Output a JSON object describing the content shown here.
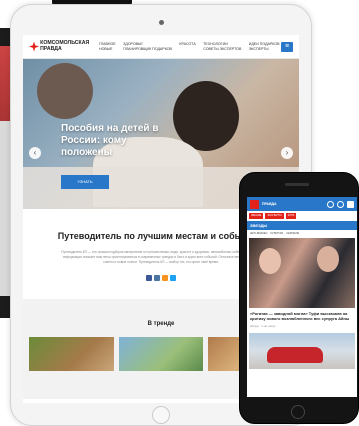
{
  "brand": {
    "logo_text": "КОМСОМОЛЬСКАЯ ПРАВДА",
    "accent": "#2977c9",
    "brand_red": "#e2231a"
  },
  "tablet": {
    "nav": [
      "ГЛАВНОЕ",
      "ЗДОРОВЬЕ",
      "КРАСОТА",
      "ТЕХНОЛОГИИ",
      "ИДЕИ ПОДАРКОВ",
      "НОВЫЕ",
      "ПЛАНИРОВЩИК ПОДАРКОВ",
      "",
      "СОВЕТЫ ЭКСПЕРТОВ",
      "ЭКСПЕРТЫ"
    ],
    "menu_icon": "menu-icon",
    "hero": {
      "title": "Пособия на детей в России: кому положены",
      "button": "Узнать"
    },
    "guide": {
      "title": "Путеводитель по лучшим местам и событиям",
      "text": "Путеводитель КП — это лучшая подборка материалов по путешествиям, моде, красоте и здоровью, автомобилям, киберспорту. Наша информация поможет вам легко ориентироваться в современных трендах и быть в курсе всех событий. Отличные места, полезные советы и новые статьи. Путеводитель КП — выбор тех, кто ценит своё время."
    },
    "trend_title": "В тренде"
  },
  "phone": {
    "logo": "ПРАВДА",
    "tabs": [
      "ЗВАНИЕ",
      "ЭКСПЕРТЫ",
      "КЛУБ"
    ],
    "stars": "ЗВЕЗДЫ",
    "tags": [
      "ШОУ-БИЗНЕС",
      "КУЛЬТУРА",
      "СЕРИАЛЫ"
    ],
    "caption": "«Рогатая — заводной могла» Туфи высказала на критику нового возлюбленного вес супруга Айны",
    "meta": "Звёзды · 1 час назад"
  }
}
